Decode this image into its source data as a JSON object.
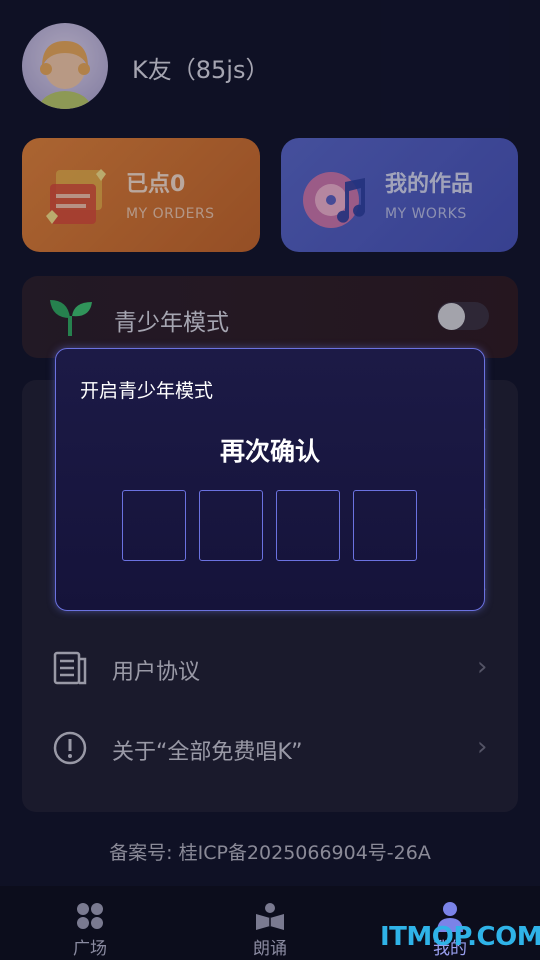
{
  "profile": {
    "username": "K友（85js）"
  },
  "cards": {
    "orders": {
      "title": "已点0",
      "subtitle": "MY ORDERS"
    },
    "works": {
      "title": "我的作品",
      "subtitle": "MY WORKS"
    }
  },
  "youth_mode": {
    "label": "青少年模式",
    "enabled": false
  },
  "list": [
    {
      "label": "用户协议",
      "icon": "document-icon"
    },
    {
      "label": "关于“全部免费唱K”",
      "icon": "info-icon"
    }
  ],
  "beian": "备案号: 桂ICP备2025066904号-26A",
  "nav": [
    {
      "label": "广场",
      "icon": "grid-icon"
    },
    {
      "label": "朗诵",
      "icon": "book-icon"
    },
    {
      "label": "我的",
      "icon": "person-icon",
      "active": true
    }
  ],
  "dialog": {
    "title": "开启青少年模式",
    "heading": "再次确认",
    "pin_length": 4
  },
  "watermark": "ITMOP.COM",
  "colors": {
    "accent": "#6b72e0",
    "orders_card": "#e0823a",
    "works_card": "#5866c8"
  }
}
